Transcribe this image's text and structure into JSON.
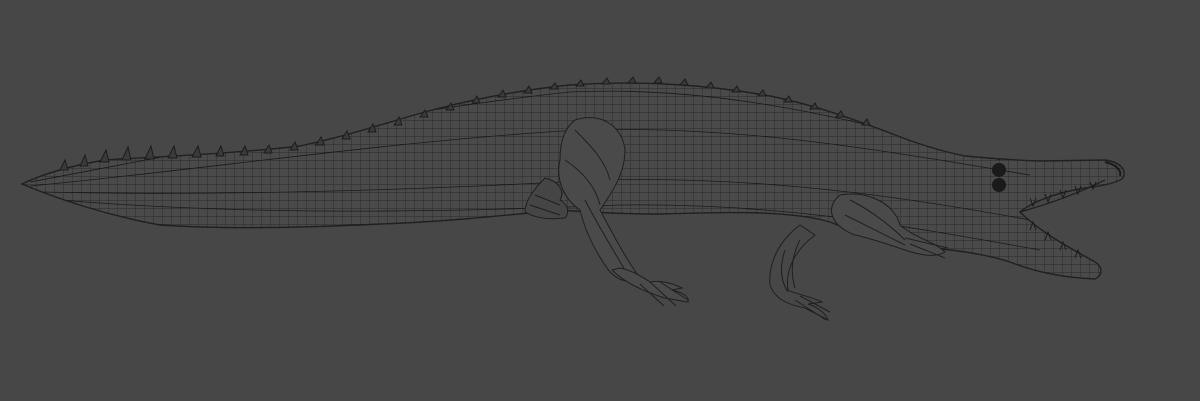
{
  "viewport": {
    "background_color": "#474747",
    "wire_color": "#1f1f1f",
    "model": {
      "icon": "crocodile-wireframe-icon",
      "display_mode": "wireframe"
    }
  }
}
